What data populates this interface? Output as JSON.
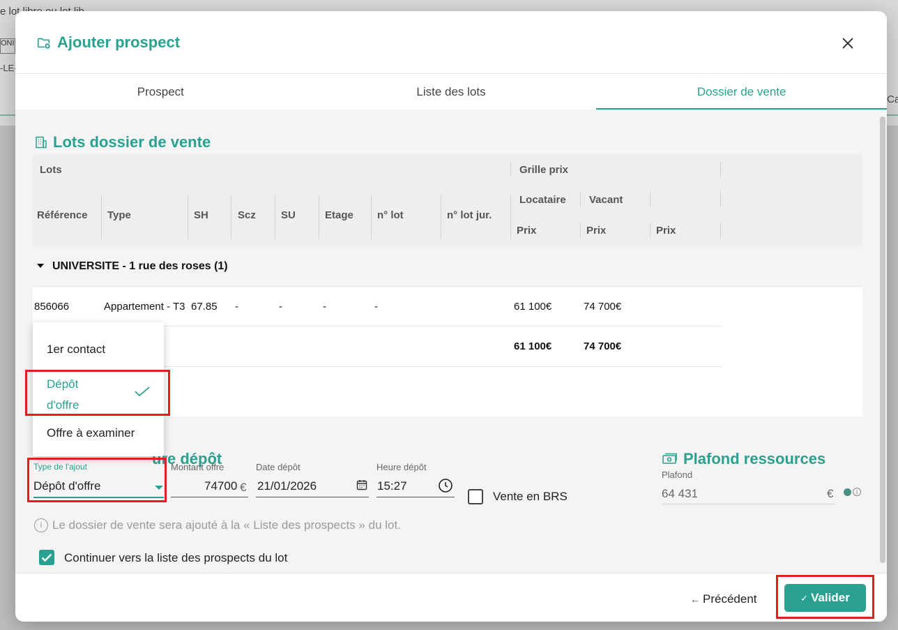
{
  "background": {
    "fragment_top": "e lot libre ou lot lib",
    "fragment_box": "ONI",
    "fragment_left": "-LE-",
    "fragment_right": "Ca"
  },
  "modal": {
    "title": "Ajouter prospect",
    "tabs": [
      {
        "label": "Prospect"
      },
      {
        "label": "Liste des lots"
      },
      {
        "label": "Dossier de vente"
      }
    ]
  },
  "lots_section": {
    "title": "Lots dossier de vente",
    "table": {
      "group_lots": "Lots",
      "group_grille": "Grille prix",
      "sub_locataire": "Locataire",
      "sub_vacant": "Vacant",
      "columns": [
        "Référence",
        "Type",
        "SH",
        "Scz",
        "SU",
        "Etage",
        "n° lot",
        "n° lot jur."
      ],
      "price_headers": [
        "Prix",
        "Prix",
        "Prix"
      ],
      "group_row": "UNIVERSITE - 1 rue des roses (1)",
      "row": {
        "reference": "856066",
        "type": "Appartement - T3",
        "sh": "67.85",
        "scz": "-",
        "su": "-",
        "etage": "-",
        "n_lot": "-",
        "prix_locataire": "61 100€",
        "prix_vacant": "74 700€"
      },
      "totals": {
        "locataire": "61 100€",
        "vacant": "74 700€"
      }
    }
  },
  "dropdown": {
    "options": [
      "1er contact",
      "Dépôt\nd'offre",
      "Offre à examiner"
    ],
    "selected_index": 1
  },
  "depot_section": {
    "title_visible": "ure dépôt",
    "type_label": "Type de l'ajout",
    "type_value": "Dépôt d'offre",
    "montant_label": "Montant offre",
    "montant_value": "74700",
    "montant_unit": "€",
    "date_label": "Date dépôt",
    "date_value": "21/01/2026",
    "heure_label": "Heure dépôt",
    "heure_value": "15:27",
    "vente_brs_label": "Vente en BRS"
  },
  "plafond_section": {
    "title": "Plafond ressources",
    "label": "Plafond",
    "value": "64 431",
    "unit": "€"
  },
  "info": {
    "text": "Le dossier de vente sera ajouté à la « Liste des prospects » du lot.",
    "continue_label": "Continuer vers la liste des prospects du lot"
  },
  "footer": {
    "prev_label": "Précédent",
    "validate_label": "Valider"
  },
  "colors": {
    "accent": "#2aa190",
    "highlight": "#e02020"
  }
}
